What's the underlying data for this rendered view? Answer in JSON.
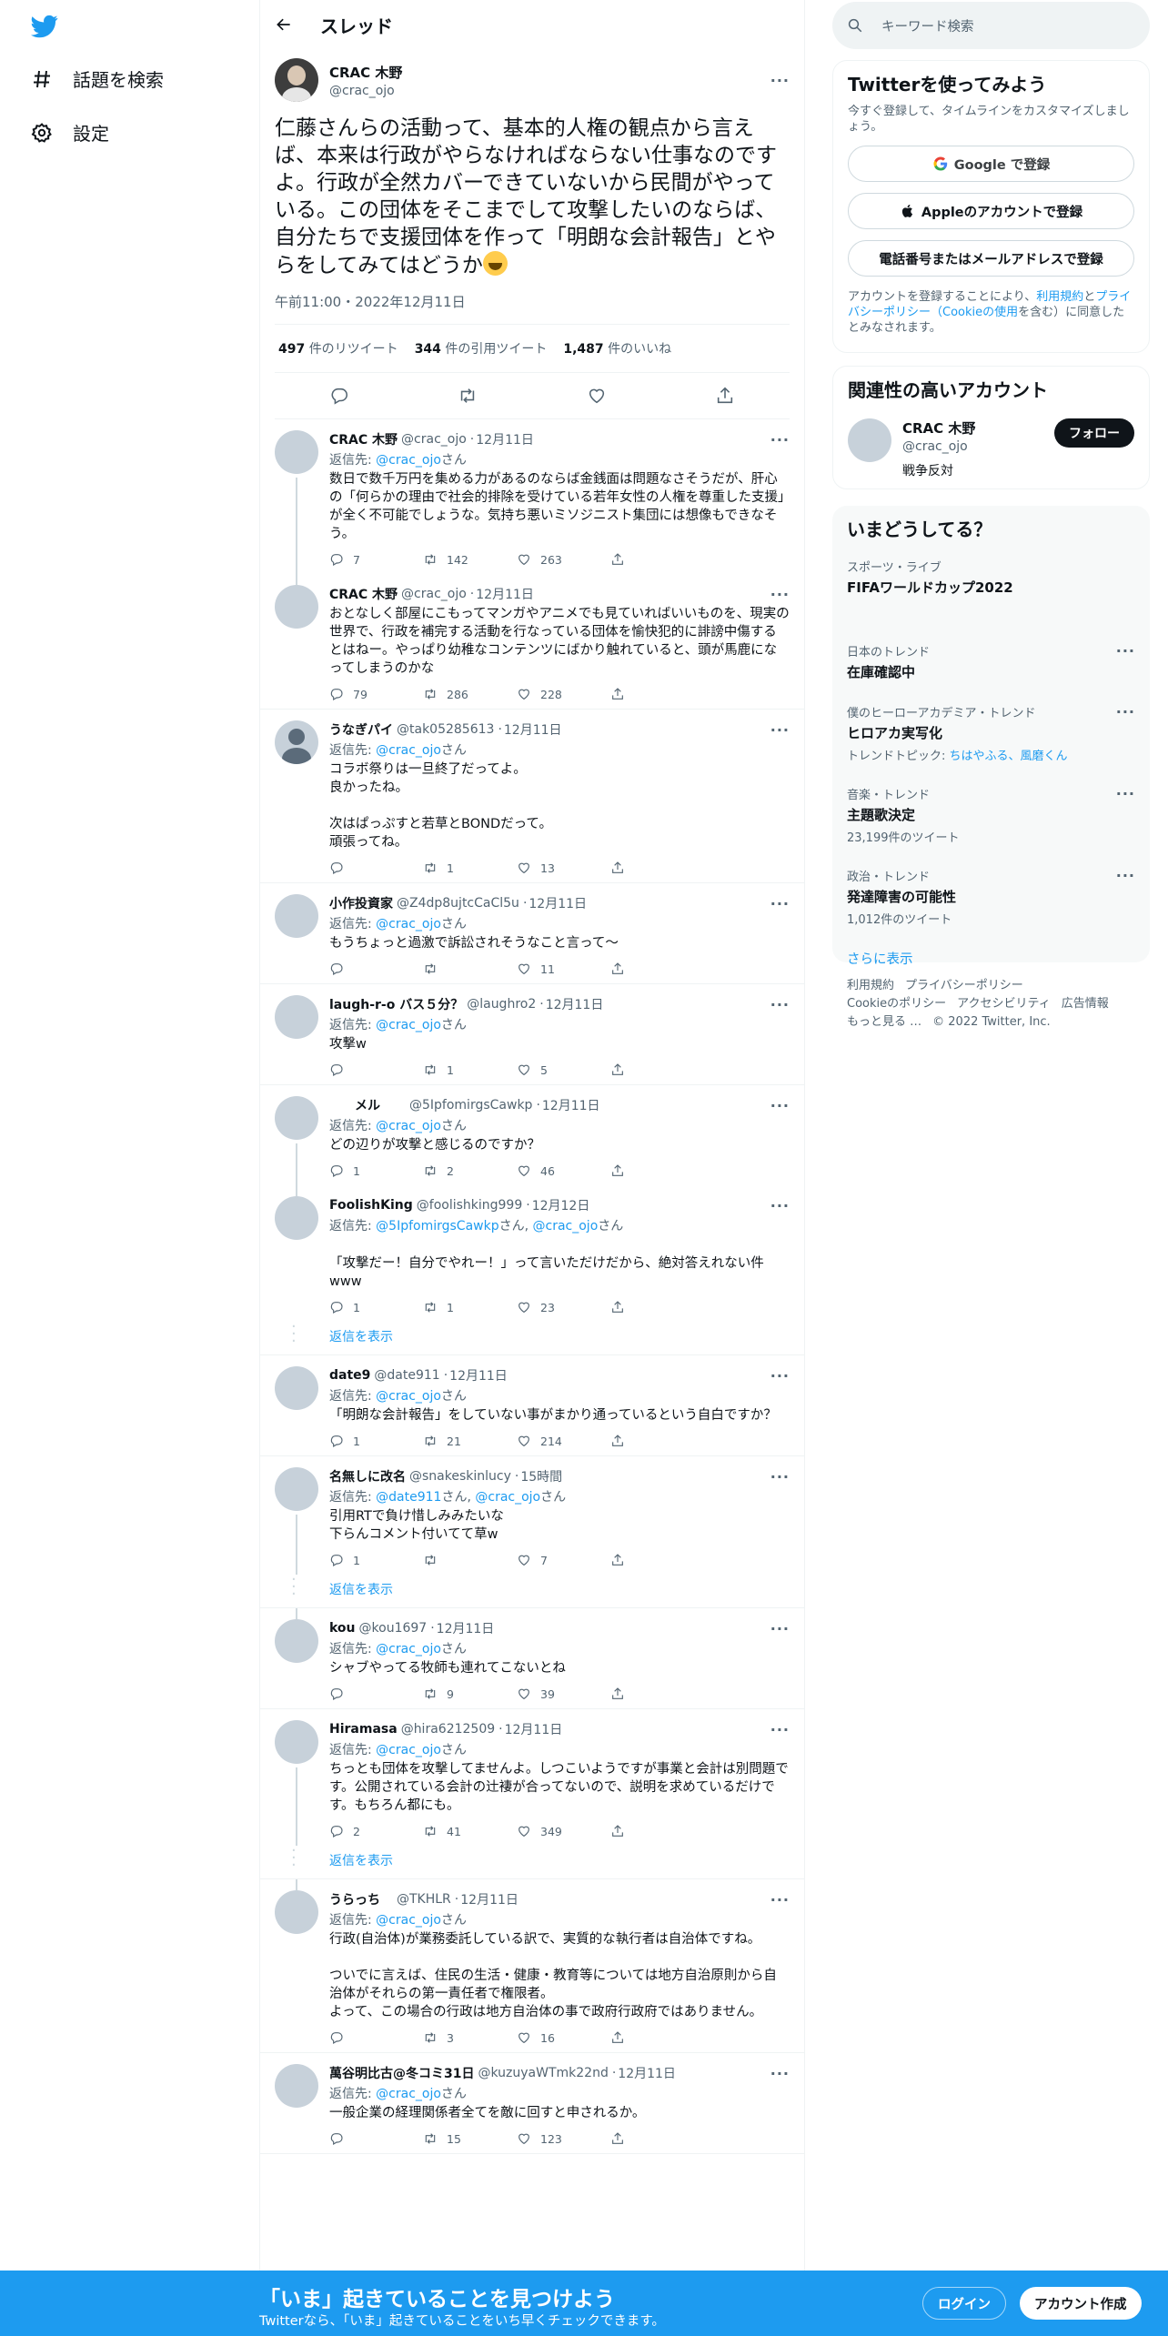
{
  "nav": {
    "explore": "話題を検索",
    "settings": "設定"
  },
  "header": {
    "title": "スレッド"
  },
  "focus": {
    "name": "CRAC 木野",
    "handle": "@crac_ojo",
    "text": "仁藤さんらの活動って、基本的人権の観点から言えば、本来は行政がやらなければならない仕事なのですよ。行政が全然カバーできていないから民間がやっている。この団体をそこまでして攻撃したいのならば、自分たちで支援団体を作って「明朗な会計報告」とやらをしてみてはどうか",
    "time": "午前11:00・2022年12月11日",
    "retweets": "497",
    "retweets_label": "件のリツイート",
    "quotes": "344",
    "quotes_label": "件の引用ツイート",
    "likes": "1,487",
    "likes_label": "件のいいね"
  },
  "replying_to": "返信先: ",
  "san": "さん",
  "show_replies": "返信を表示",
  "tweets": [
    {
      "name": "CRAC 木野",
      "handle": "@crac_ojo",
      "date": "12月11日",
      "reply_to": "@crac_ojo",
      "text": "数日で数千万円を集める力があるのならば金銭面は問題なさそうだが、肝心の「何らかの理由で社会的排除を受けている若年女性の人権を尊重した支援」が全く不可能でしょうな。気持ち悪いミソジニスト集団には想像もできなそう。",
      "replies": "7",
      "retweets": "142",
      "likes": "263"
    },
    {
      "name": "CRAC 木野",
      "handle": "@crac_ojo",
      "date": "12月11日",
      "text": "おとなしく部屋にこもってマンガやアニメでも見ていればいいものを、現実の世界で、行政を補完する活動を行なっている団体を愉快犯的に誹謗中傷するとはねー。やっぱり幼稚なコンテンツにばかり触れていると、頭が馬鹿になってしまうのかな",
      "replies": "79",
      "retweets": "286",
      "likes": "228"
    },
    {
      "name": "うなぎパイ",
      "handle": "@tak05285613",
      "date": "12月11日",
      "reply_to": "@crac_ojo",
      "text": "コラボ祭りは一旦終了だってよ。\n良かったね。\n\n次はぱっぷすと若草とBONDだって。\n頑張ってね。",
      "replies": "",
      "retweets": "1",
      "likes": "13"
    },
    {
      "name": "小作投資家",
      "handle": "@Z4dp8ujtcCaCl5u",
      "date": "12月11日",
      "reply_to": "@crac_ojo",
      "text": "もうちょっと過激で訴訟されそうなこと言って～",
      "replies": "",
      "retweets": "",
      "likes": "11"
    },
    {
      "name": "laugh-r-o バス５分？",
      "handle": "@laughro2",
      "date": "12月11日",
      "reply_to": "@crac_ojo",
      "text": "攻撃w",
      "replies": "",
      "retweets": "1",
      "likes": "5"
    },
    {
      "name": "　　メル　　",
      "handle": "@5IpfomirgsCawkp",
      "date": "12月11日",
      "reply_to": "@crac_ojo",
      "text": "どの辺りが攻撃と感じるのですか？",
      "replies": "1",
      "retweets": "2",
      "likes": "46"
    },
    {
      "name": "FoolishKing",
      "handle": "@foolishking999",
      "date": "12月12日",
      "reply_to": "@5IpfomirgsCawkp",
      "reply_to2": "@crac_ojo",
      "text": "\n「攻撃だー！自分でやれー！」って言いただけだから、絶対答えれない件www",
      "replies": "1",
      "retweets": "1",
      "likes": "23"
    },
    {
      "name": "date9",
      "handle": "@date911",
      "date": "12月11日",
      "reply_to": "@crac_ojo",
      "text": "「明朗な会計報告」をしていない事がまかり通っているという自白ですか？",
      "replies": "1",
      "retweets": "21",
      "likes": "214"
    },
    {
      "name": "名無しに改名",
      "handle": "@snakeskinlucy",
      "date": "15時間",
      "reply_to": "@date911",
      "reply_to2": "@crac_ojo",
      "text": "引用RTで負け惜しみみたいな\n下らんコメント付いてて草w",
      "replies": "1",
      "retweets": "",
      "likes": "7"
    },
    {
      "name": "kou",
      "handle": "@kou1697",
      "date": "12月11日",
      "reply_to": "@crac_ojo",
      "text": "シャブやってる牧師も連れてこないとね",
      "replies": "",
      "retweets": "9",
      "likes": "39"
    },
    {
      "name": "Hiramasa",
      "handle": "@hira6212509",
      "date": "12月11日",
      "reply_to": "@crac_ojo",
      "text": "ちっとも団体を攻撃してませんよ。しつこいようですが事業と会計は別問題です。公開されている会計の辻褄が合ってないので、説明を求めているだけです。もちろん都にも。",
      "replies": "2",
      "retweets": "41",
      "likes": "349"
    },
    {
      "name": "うらっち　",
      "handle": "@TKHLR",
      "date": "12月11日",
      "reply_to": "@crac_ojo",
      "text": "行政(自治体)が業務委託している訳で、実質的な執行者は自治体ですね。\n\nついでに言えば、住民の生活・健康・教育等については地方自治原則から自治体がそれらの第一責任者で権限者。\nよって、この場合の行政は地方自治体の事で政府行政府ではありません。",
      "replies": "",
      "retweets": "3",
      "likes": "16"
    },
    {
      "name": "萬谷明比古@冬コミ31日",
      "handle": "@kuzuyaWTmk22nd",
      "date": "12月11日",
      "reply_to": "@crac_ojo",
      "text": "一般企業の経理関係者全てを敵に回すと申されるか。",
      "replies": "",
      "retweets": "15",
      "likes": "123"
    }
  ],
  "right": {
    "search_placeholder": "キーワード検索",
    "signup": {
      "title": "Twitterを使ってみよう",
      "sub": "今すぐ登録して、タイムラインをカスタマイズしましょう。",
      "google": "Google で登録",
      "apple": "Appleのアカウントで登録",
      "phone": "電話番号またはメールアドレスで登録",
      "terms_pre": "アカウントを登録することにより、",
      "terms_link1": "利用規約",
      "terms_mid": "と",
      "terms_link2": "プライバシーポリシー（Cookieの使用",
      "terms_post": "を含む）に同意したとみなされます。"
    },
    "relevant": {
      "title": "関連性の高いアカウント",
      "name": "CRAC 木野",
      "handle": "@crac_ojo",
      "bio": "戦争反対",
      "follow": "フォロー"
    },
    "trends": {
      "title": "いまどうしてる？",
      "items": [
        {
          "context": "スポーツ・ライブ",
          "title": "FIFAワールドカップ2022",
          "sub": ""
        },
        {
          "context": "日本のトレンド",
          "title": "在庫確認中",
          "sub": ""
        },
        {
          "context": "僕のヒーローアカデミア・トレンド",
          "title": "ヒロアカ実写化",
          "sub_pre": "トレンドトピック: ",
          "sub_link": "ちはやふる、風磨くん"
        },
        {
          "context": "音楽・トレンド",
          "title": "主題歌決定",
          "sub": "23,199件のツイート"
        },
        {
          "context": "政治・トレンド",
          "title": "発達障害の可能性",
          "sub": "1,012件のツイート"
        }
      ],
      "more": "さらに表示"
    },
    "footer": {
      "terms": "利用規約",
      "privacy": "プライバシーポリシー",
      "cookie": "Cookieのポリシー",
      "access": "アクセシビリティ",
      "ads": "広告情報",
      "more": "もっと見る …",
      "copy": "© 2022 Twitter, Inc."
    }
  },
  "bottombar": {
    "title": "「いま」起きていることを見つけよう",
    "sub": "Twitterなら、「いま」起きていることをいち早くチェックできます。",
    "login": "ログイン",
    "signup": "アカウント作成"
  },
  "colors": {
    "accent": "#1d9bf0",
    "text": "#0f1419",
    "muted": "#536471"
  }
}
